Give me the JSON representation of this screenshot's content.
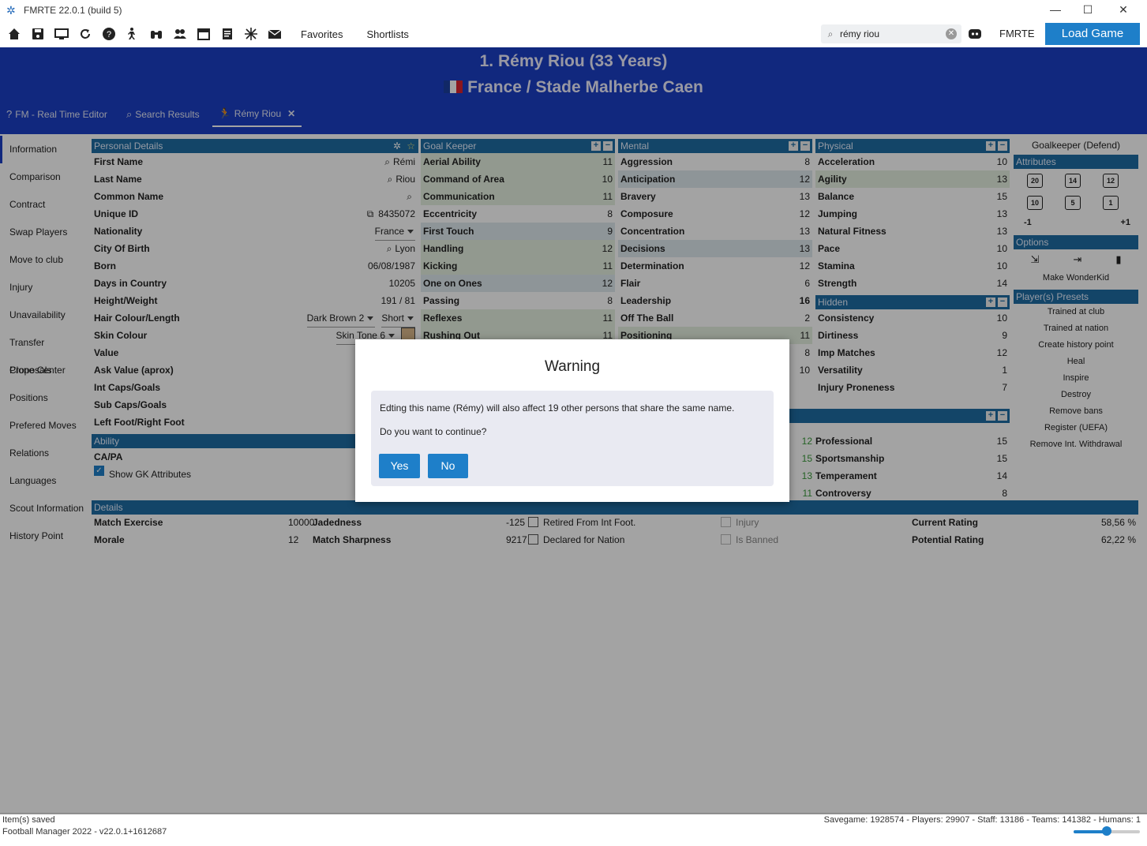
{
  "window": {
    "title": "FMRTE 22.0.1 (build 5)",
    "minimize": "—",
    "maximize": "☐",
    "close": "✕"
  },
  "toolbar": {
    "icons": [
      "home-icon",
      "save-icon",
      "monitor-icon",
      "refresh-icon",
      "help-icon",
      "player-icon",
      "binoculars-icon",
      "people-icon",
      "calendar-icon",
      "document-icon",
      "snowflake-icon",
      "mail-icon"
    ],
    "favorites": "Favorites",
    "shortlists": "Shortlists",
    "search_value": "rémy riou",
    "search_clear": "✕",
    "fmrte": "FMRTE",
    "load_game": "Load Game"
  },
  "banner": {
    "line1": "1. Rémy Riou (33 Years)",
    "line2": "France / Stade Malherbe Caen",
    "flag_colors": [
      "#1b3fa0",
      "#ffffff",
      "#d9232e"
    ]
  },
  "tabs": [
    {
      "icon": "?",
      "label": "FM - Real Time Editor"
    },
    {
      "icon": "⌕",
      "label": "Search Results"
    },
    {
      "icon": "🏃",
      "label": "Rémy Riou",
      "close": "✕"
    }
  ],
  "nav": [
    "Information",
    "Comparison",
    "Contract",
    "Swap Players",
    "Move to club",
    "Injury",
    "Unavailability",
    "Transfer Proposals",
    "Clone Center",
    "Positions",
    "Prefered Moves",
    "Relations",
    "Languages",
    "Scout Information",
    "History Point"
  ],
  "personal": {
    "header": "Personal Details",
    "rows": [
      {
        "label": "First Name",
        "value": "Rémi"
      },
      {
        "label": "Last Name",
        "value": "Riou"
      },
      {
        "label": "Common Name",
        "value": ""
      },
      {
        "label": "Unique ID",
        "value": "8435072"
      },
      {
        "label": "Nationality",
        "value": "France"
      },
      {
        "label": "City Of Birth",
        "value": "Lyon"
      },
      {
        "label": "Born",
        "value": "06/08/1987"
      },
      {
        "label": "Days in Country",
        "value": "10205"
      },
      {
        "label": "Height/Weight",
        "value": "191 / 81"
      },
      {
        "label": "Hair Colour/Length",
        "value": "Dark Brown 2",
        "value2": "Short"
      },
      {
        "label": "Skin Colour",
        "value": "Skin Tone 6"
      },
      {
        "label": "Value",
        "value": ""
      },
      {
        "label": "Ask Value (aprox)",
        "value": ""
      },
      {
        "label": "Int Caps/Goals",
        "value": ""
      },
      {
        "label": "Sub Caps/Goals",
        "value": ""
      },
      {
        "label": "Left Foot/Right Foot",
        "value": ""
      }
    ]
  },
  "ability": {
    "header": "Ability",
    "label": "CA/PA",
    "show_gk": "Show GK Attributes"
  },
  "goalkeeper": {
    "header": "Goal Keeper",
    "rows": [
      {
        "label": "Aerial Ability",
        "value": "11",
        "style": "green"
      },
      {
        "label": "Command of Area",
        "value": "10",
        "style": "green"
      },
      {
        "label": "Communication",
        "value": "11",
        "style": "green"
      },
      {
        "label": "Eccentricity",
        "value": "8",
        "style": ""
      },
      {
        "label": "First Touch",
        "value": "9",
        "style": "hl"
      },
      {
        "label": "Handling",
        "value": "12",
        "style": "green"
      },
      {
        "label": "Kicking",
        "value": "11",
        "style": "green"
      },
      {
        "label": "One on Ones",
        "value": "12",
        "style": "hl"
      },
      {
        "label": "Passing",
        "value": "8",
        "style": ""
      },
      {
        "label": "Reflexes",
        "value": "11",
        "style": "green"
      },
      {
        "label": "Rushing Out",
        "value": "11",
        "style": "green"
      }
    ]
  },
  "mental": {
    "header": "Mental",
    "rows": [
      {
        "label": "Aggression",
        "value": "8",
        "style": ""
      },
      {
        "label": "Anticipation",
        "value": "12",
        "style": "hl"
      },
      {
        "label": "Bravery",
        "value": "13",
        "style": ""
      },
      {
        "label": "Composure",
        "value": "12",
        "style": ""
      },
      {
        "label": "Concentration",
        "value": "13",
        "style": ""
      },
      {
        "label": "Decisions",
        "value": "13",
        "style": "hl"
      },
      {
        "label": "Determination",
        "value": "12",
        "style": ""
      },
      {
        "label": "Flair",
        "value": "6",
        "style": ""
      },
      {
        "label": "Leadership",
        "value": "16",
        "style": ""
      },
      {
        "label": "Off The Ball",
        "value": "2",
        "style": ""
      },
      {
        "label": "Positioning",
        "value": "11",
        "style": "green"
      }
    ],
    "partial_values": [
      "8",
      "10"
    ]
  },
  "physical": {
    "header": "Physical",
    "rows": [
      {
        "label": "Acceleration",
        "value": "10",
        "style": ""
      },
      {
        "label": "Agility",
        "value": "13",
        "style": "green"
      },
      {
        "label": "Balance",
        "value": "15",
        "style": ""
      },
      {
        "label": "Jumping",
        "value": "13",
        "style": ""
      },
      {
        "label": "Natural Fitness",
        "value": "13",
        "style": ""
      },
      {
        "label": "Pace",
        "value": "10",
        "style": ""
      },
      {
        "label": "Stamina",
        "value": "10",
        "style": ""
      },
      {
        "label": "Strength",
        "value": "14",
        "style": ""
      }
    ]
  },
  "hidden": {
    "header": "Hidden",
    "rows": [
      {
        "label": "Consistency",
        "value": "10"
      },
      {
        "label": "Dirtiness",
        "value": "9"
      },
      {
        "label": "Imp Matches",
        "value": "12"
      },
      {
        "label": "Versatility",
        "value": "1"
      },
      {
        "label": "Injury Proneness",
        "value": "7"
      }
    ]
  },
  "personality": {
    "rows": [
      {
        "left": "12",
        "label": "Professional",
        "value": "15"
      },
      {
        "left": "15",
        "label": "Sportsmanship",
        "value": "15"
      },
      {
        "left": "13",
        "label": "Temperament",
        "value": "14"
      },
      {
        "left": "11",
        "label": "Controversy",
        "value": "8"
      }
    ]
  },
  "rightcol": {
    "role": "Goalkeeper (Defend)",
    "attributes_header": "Attributes",
    "attr_buttons": [
      "20",
      "14",
      "12",
      "10",
      "5",
      "1"
    ],
    "minus": "-1",
    "plus": "+1",
    "options_header": "Options",
    "make_wonderkid": "Make WonderKid",
    "presets_header": "Player(s) Presets",
    "presets": [
      "Trained at club",
      "Trained at nation",
      "Create history point",
      "Heal",
      "Inspire",
      "Destroy",
      "Remove bans",
      "Register (UEFA)",
      "Remove Int. Withdrawal"
    ]
  },
  "details": {
    "header": "Details",
    "match_exercise_label": "Match Exercise",
    "match_exercise": "10000",
    "jadedness_label": "Jadedness",
    "jadedness": "-125",
    "retired_label": "Retired From Int Foot.",
    "injury_label": "Injury",
    "current_rating_label": "Current Rating",
    "current_rating": "58,56 %",
    "morale_label": "Morale",
    "morale": "12",
    "sharpness_label": "Match Sharpness",
    "sharpness": "9217",
    "declared_label": "Declared for Nation",
    "banned_label": "Is Banned",
    "potential_rating_label": "Potential Rating",
    "potential_rating": "62,22 %"
  },
  "dialog": {
    "title": "Warning",
    "message": "Edting this name (Rémy) will also affect 19 other persons that share the same name.",
    "question": "Do you want to continue?",
    "yes": "Yes",
    "no": "No"
  },
  "status": {
    "line1": "Item(s) saved",
    "line2": "Football Manager 2022 - v22.0.1+1612687",
    "stats": "Savegame: 1928574 - Players: 29907 - Staff: 13186 - Teams: 141382 - Humans: 1",
    "zoom_level": 0.5
  }
}
